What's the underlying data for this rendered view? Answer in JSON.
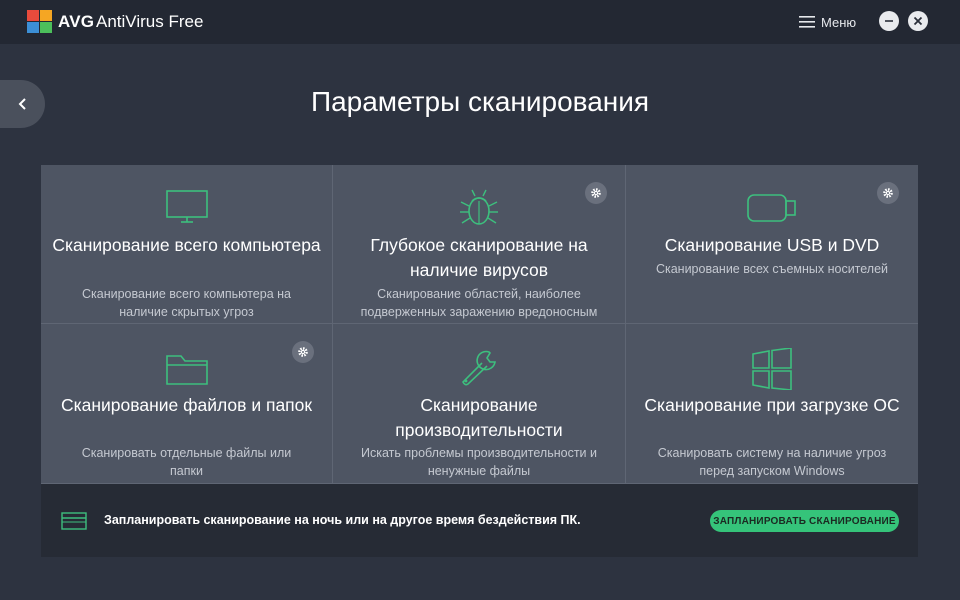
{
  "titlebar": {
    "brand": "AVG",
    "product": "AntiVirus Free",
    "menu_label": "Меню"
  },
  "page": {
    "title": "Параметры сканирования"
  },
  "tiles": [
    {
      "title": "Сканирование всего компьютера",
      "description": "Сканирование всего компьютера на наличие скрытых угроз",
      "icon": "monitor-icon",
      "has_settings": false
    },
    {
      "title": "Глубокое сканирование на наличие вирусов",
      "description": "Сканирование областей, наиболее подверженных заражению вредоносным ПО",
      "icon": "bug-icon",
      "has_settings": true
    },
    {
      "title": "Сканирование USB и DVD",
      "description": "Сканирование всех съемных носителей",
      "icon": "usb-drive-icon",
      "has_settings": true
    },
    {
      "title": "Сканирование файлов и папок",
      "description": "Сканировать отдельные файлы или папки",
      "icon": "folder-icon",
      "has_settings": true
    },
    {
      "title": "Сканирование производительности",
      "description": "Искать проблемы производительности и ненужные файлы",
      "icon": "wrench-icon",
      "has_settings": false
    },
    {
      "title": "Сканирование при загрузке ОС",
      "description": "Сканировать систему на наличие угроз перед запуском Windows",
      "icon": "windows-icon",
      "has_settings": false
    }
  ],
  "schedule": {
    "text": "Запланировать сканирование на ночь или на другое время бездействия ПК.",
    "button_label": "ЗАПЛАНИРОВАТЬ СКАНИРОВАНИЕ"
  },
  "colors": {
    "background": "#2d3340",
    "titlebar": "#232833",
    "tile": "#4e5563",
    "accent_green": "#35c47a",
    "icon_green": "#3dbf7e"
  }
}
